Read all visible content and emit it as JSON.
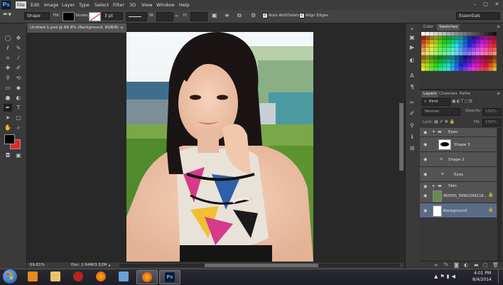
{
  "menu": {
    "app_logo": "Ps",
    "items": [
      "File",
      "Edit",
      "Image",
      "Layer",
      "Type",
      "Select",
      "Filter",
      "3D",
      "View",
      "Window",
      "Help"
    ],
    "active": "File"
  },
  "options": {
    "mode": "Shape",
    "fill_label": "Fill:",
    "stroke_label": "Stroke:",
    "stroke_size": "3 pt",
    "w_label": "W:",
    "h_label": "H:",
    "auto_add_delete": "Auto Add/Delete",
    "align_edges": "Align Edges",
    "workspace": "Essentials"
  },
  "document": {
    "tab_title": "Untitled-1.psd @ 69.8% (Background, RGB/8)",
    "zoom": "69.81%",
    "doc_info": "Doc: 2.64M/3.52M"
  },
  "colors": {
    "foreground": "#000000",
    "background": "#e3262c"
  },
  "swatch_panel": {
    "tabs": [
      "Color",
      "Swatches"
    ],
    "active_tab": "Swatches"
  },
  "layers_panel": {
    "tabs": [
      "Layers",
      "Channels",
      "Paths"
    ],
    "active_tab": "Layers",
    "filter_kind": "Kind",
    "blend_mode": "Normal",
    "opacity_label": "Opacity:",
    "opacity_value": "100%",
    "lock_label": "Lock:",
    "fill_label": "Fill:",
    "fill_value": "100%",
    "layers": [
      {
        "name": "Eyes",
        "kind": "group"
      },
      {
        "name": "Shape 3",
        "kind": "shape"
      },
      {
        "name": "Shape 2",
        "kind": "shape"
      },
      {
        "name": "Eyes",
        "kind": "shape"
      },
      {
        "name": "Skin",
        "kind": "group"
      },
      {
        "name": "963055_58901566116...",
        "kind": "image"
      },
      {
        "name": "Background",
        "kind": "background"
      }
    ]
  },
  "taskbar": {
    "time": "4:01 PM",
    "date": "8/4/2014",
    "apps": [
      "start",
      "media-player",
      "file-explorer",
      "app-red",
      "firefox",
      "app-blue",
      "firefox-2",
      "photoshop"
    ]
  }
}
